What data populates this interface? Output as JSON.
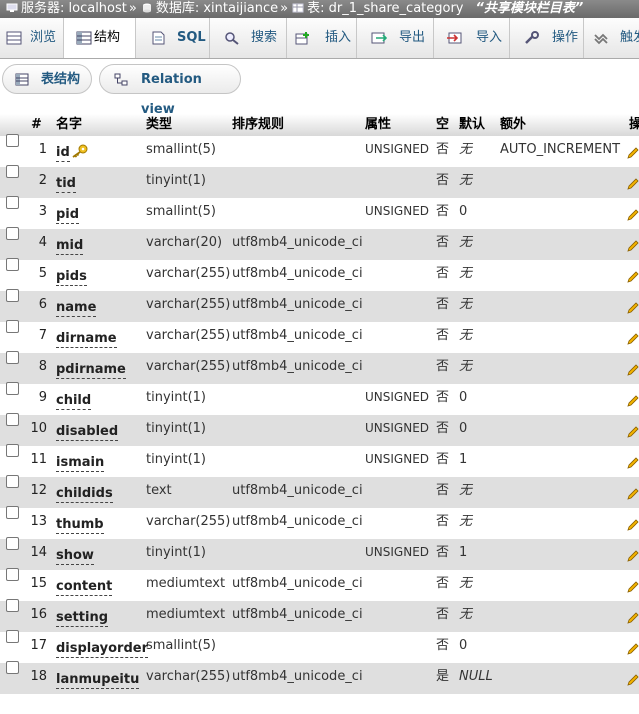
{
  "breadcrumb": {
    "server": "服务器: localhost",
    "database": "数据库: xintaijiance",
    "table": "表: dr_1_share_category",
    "comment": "“共享模块栏目表”"
  },
  "menu": {
    "tabs": [
      {
        "label": "浏览",
        "icon": "browse-icon"
      },
      {
        "label": "结构",
        "icon": "structure-icon",
        "active": true
      },
      {
        "label": "SQL",
        "icon": "sql-icon"
      },
      {
        "label": "搜索",
        "icon": "search-icon"
      },
      {
        "label": "插入",
        "icon": "insert-icon"
      },
      {
        "label": "导出",
        "icon": "export-icon"
      },
      {
        "label": "导入",
        "icon": "import-icon"
      },
      {
        "label": "操作",
        "icon": "operations-icon"
      },
      {
        "label": "触发",
        "icon": "triggers-icon"
      }
    ]
  },
  "subtabs": {
    "table_structure": "表结构",
    "relation_view": "Relation view"
  },
  "columns": {
    "num": "#",
    "name": "名字",
    "type": "类型",
    "collation": "排序规则",
    "attributes": "属性",
    "null": "空",
    "default": "默认",
    "extra": "额外",
    "action": "操"
  },
  "rows": [
    {
      "num": "1",
      "name": "id",
      "type": "smallint(5)",
      "collation": "",
      "attributes": "UNSIGNED",
      "null": "否",
      "default": "无",
      "extra": "AUTO_INCREMENT",
      "primary": true
    },
    {
      "num": "2",
      "name": "tid",
      "type": "tinyint(1)",
      "collation": "",
      "attributes": "",
      "null": "否",
      "default": "无",
      "extra": ""
    },
    {
      "num": "3",
      "name": "pid",
      "type": "smallint(5)",
      "collation": "",
      "attributes": "UNSIGNED",
      "null": "否",
      "default": "0",
      "extra": ""
    },
    {
      "num": "4",
      "name": "mid",
      "type": "varchar(20)",
      "collation": "utf8mb4_unicode_ci",
      "attributes": "",
      "null": "否",
      "default": "无",
      "extra": ""
    },
    {
      "num": "5",
      "name": "pids",
      "type": "varchar(255)",
      "collation": "utf8mb4_unicode_ci",
      "attributes": "",
      "null": "否",
      "default": "无",
      "extra": ""
    },
    {
      "num": "6",
      "name": "name",
      "type": "varchar(255)",
      "collation": "utf8mb4_unicode_ci",
      "attributes": "",
      "null": "否",
      "default": "无",
      "extra": ""
    },
    {
      "num": "7",
      "name": "dirname",
      "type": "varchar(255)",
      "collation": "utf8mb4_unicode_ci",
      "attributes": "",
      "null": "否",
      "default": "无",
      "extra": ""
    },
    {
      "num": "8",
      "name": "pdirname",
      "type": "varchar(255)",
      "collation": "utf8mb4_unicode_ci",
      "attributes": "",
      "null": "否",
      "default": "无",
      "extra": ""
    },
    {
      "num": "9",
      "name": "child",
      "type": "tinyint(1)",
      "collation": "",
      "attributes": "UNSIGNED",
      "null": "否",
      "default": "0",
      "extra": ""
    },
    {
      "num": "10",
      "name": "disabled",
      "type": "tinyint(1)",
      "collation": "",
      "attributes": "UNSIGNED",
      "null": "否",
      "default": "0",
      "extra": ""
    },
    {
      "num": "11",
      "name": "ismain",
      "type": "tinyint(1)",
      "collation": "",
      "attributes": "UNSIGNED",
      "null": "否",
      "default": "1",
      "extra": ""
    },
    {
      "num": "12",
      "name": "childids",
      "type": "text",
      "collation": "utf8mb4_unicode_ci",
      "attributes": "",
      "null": "否",
      "default": "无",
      "extra": ""
    },
    {
      "num": "13",
      "name": "thumb",
      "type": "varchar(255)",
      "collation": "utf8mb4_unicode_ci",
      "attributes": "",
      "null": "否",
      "default": "无",
      "extra": ""
    },
    {
      "num": "14",
      "name": "show",
      "type": "tinyint(1)",
      "collation": "",
      "attributes": "UNSIGNED",
      "null": "否",
      "default": "1",
      "extra": ""
    },
    {
      "num": "15",
      "name": "content",
      "type": "mediumtext",
      "collation": "utf8mb4_unicode_ci",
      "attributes": "",
      "null": "否",
      "default": "无",
      "extra": ""
    },
    {
      "num": "16",
      "name": "setting",
      "type": "mediumtext",
      "collation": "utf8mb4_unicode_ci",
      "attributes": "",
      "null": "否",
      "default": "无",
      "extra": ""
    },
    {
      "num": "17",
      "name": "displayorder",
      "type": "smallint(5)",
      "collation": "",
      "attributes": "",
      "null": "否",
      "default": "0",
      "extra": ""
    },
    {
      "num": "18",
      "name": "lanmupeitu",
      "type": "varchar(255)",
      "collation": "utf8mb4_unicode_ci",
      "attributes": "",
      "null": "是",
      "default": "NULL",
      "extra": ""
    }
  ]
}
